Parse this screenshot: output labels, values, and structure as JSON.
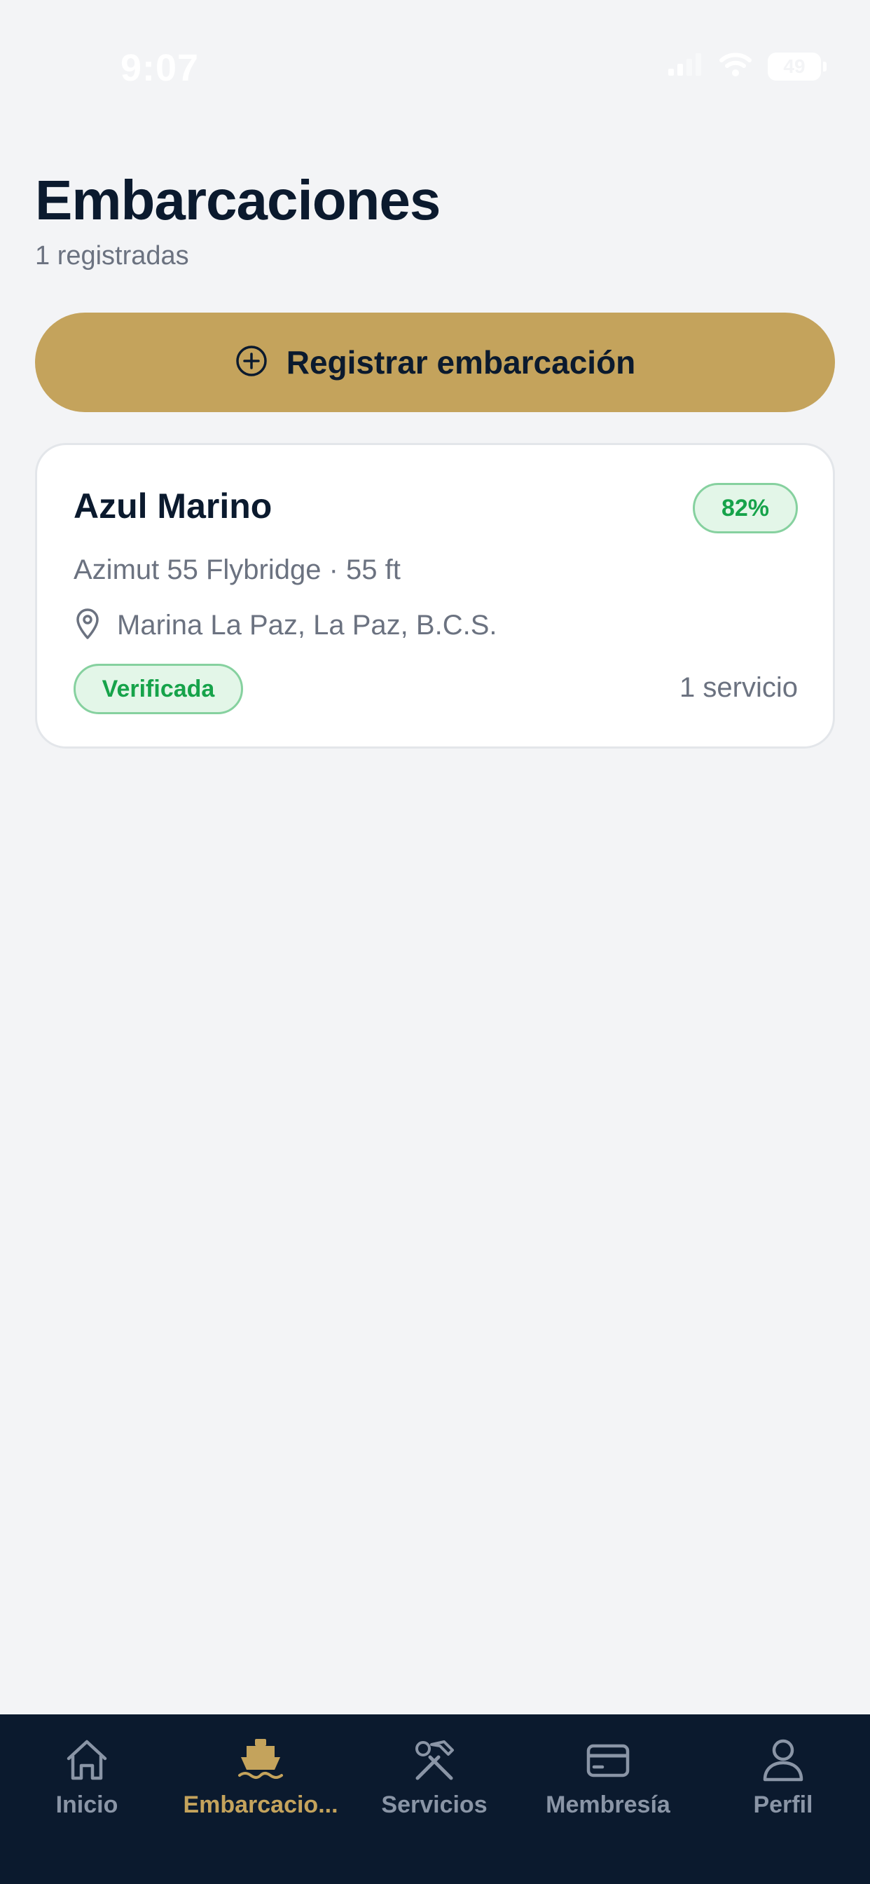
{
  "status_bar": {
    "time": "9:07",
    "battery": "49"
  },
  "header": {
    "title": "Embarcaciones",
    "subtitle": "1 registradas"
  },
  "register_button": {
    "label": "Registrar embarcación",
    "icon": "plus-circle-icon"
  },
  "vessels": [
    {
      "name": "Azul Marino",
      "completion": "82%",
      "model": "Azimut 55 Flybridge · 55 ft",
      "location": "Marina La Paz, La Paz, B.C.S.",
      "status": "Verificada",
      "services": "1 servicio"
    }
  ],
  "tab_bar": {
    "items": [
      {
        "label": "Inicio",
        "icon": "home-icon",
        "active": false
      },
      {
        "label": "Embarcacio...",
        "icon": "boat-icon",
        "active": true
      },
      {
        "label": "Servicios",
        "icon": "tools-icon",
        "active": false
      },
      {
        "label": "Membresía",
        "icon": "credit-card-icon",
        "active": false
      },
      {
        "label": "Perfil",
        "icon": "user-icon",
        "active": false
      }
    ]
  },
  "colors": {
    "background": "#f3f4f6",
    "accent": "#c4a35c",
    "navy": "#0b1a2e",
    "success": "#16a34a",
    "muted": "#6b7280",
    "tab_inactive": "#8a95a6"
  }
}
